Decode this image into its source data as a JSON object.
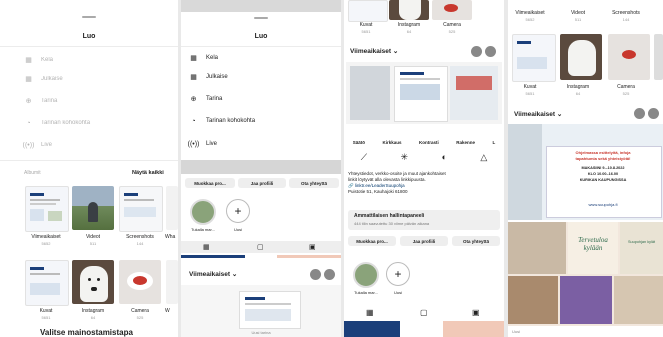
{
  "sheet": {
    "title": "Luo",
    "items": [
      {
        "label": "Kela",
        "icon": "grid-icon"
      },
      {
        "label": "Julkaise",
        "icon": "grid-icon"
      },
      {
        "label": "Tarina",
        "icon": "plus-circle-icon"
      },
      {
        "label": "Tarinan kohokohta",
        "icon": "history-icon"
      },
      {
        "label": "Live",
        "icon": "live-icon"
      }
    ]
  },
  "gallery": {
    "section_label": "Albumit",
    "see_all": "Näytä kaikki",
    "albums": [
      {
        "name": "Viimeaikaiset",
        "count": "5652"
      },
      {
        "name": "Videot",
        "count": "511"
      },
      {
        "name": "Screenshots",
        "count": "144"
      },
      {
        "name": "Wha",
        "count": ""
      }
    ],
    "albums2": [
      {
        "name": "Kuvat",
        "count": "5651"
      },
      {
        "name": "Instagram",
        "count": "64"
      },
      {
        "name": "Camera",
        "count": "525"
      },
      {
        "name": "W",
        "count": ""
      }
    ],
    "footer_text": "Valitse mainostamistapa"
  },
  "profile": {
    "edit_button": "Muokkaa pro...",
    "share_button": "Jaa profiili",
    "contact_button": "Ota yhteyttä",
    "edit_button2": "Muokkaa pro...",
    "share_button2": "Jaa profiili",
    "contact_button2": "Ota yhteyttä",
    "highlight_label": "Tukalla mar...",
    "new_label": "Uusi",
    "recent_label": "Viimeaikaiset",
    "recent_label_top": "Viimeaikaiset",
    "recent_label_right": "Viimeaikaiset",
    "new_story_label": "Uusi tarina"
  },
  "filters": [
    "Säätö",
    "Kirkkaus",
    "Kontrasti",
    "Rakenne",
    "L"
  ],
  "bio": {
    "line1": "Yhteystiedot, verkko-osoite ja muut ajankohtaiset",
    "line2": "linkit löytyvät alla olevasta linkkipuusta.",
    "link": "linktr.ee/LeaderSuupohja",
    "address": "Puistotie 51, Kauhajoki 61800",
    "dashboard_title": "Ammattilaisen hallintapaneeli",
    "dashboard_sub": "444 tilin saavutettu 30 viime päivän aikana"
  },
  "right_albums": [
    {
      "name": "Viimeaikaiset",
      "count": "5652"
    },
    {
      "name": "Videot",
      "count": "511"
    },
    {
      "name": "Screenshots",
      "count": "144"
    }
  ],
  "right_albums2": [
    {
      "name": "Kuvat",
      "count": "5651"
    },
    {
      "name": "Instagram",
      "count": "64"
    },
    {
      "name": "Camera",
      "count": "525"
    }
  ],
  "albums_top_s3": [
    {
      "name": "Kuvat",
      "count": "5651"
    },
    {
      "name": "Instagram",
      "count": "64"
    },
    {
      "name": "Camera",
      "count": "525"
    }
  ],
  "poster": {
    "event_line1": "Ohjelmassa esittelyitä, infoja",
    "event_line2": "tapahtumia sekä yhteistyötä!",
    "dates": "MAKASIINI 9.–10.8.2022",
    "hours": "KLO 10.00–16.00",
    "place": "KURIKAN KAUPUNGISSA",
    "web": "www.suupohja.fi",
    "title": "Tervetuloa kylään",
    "subtitle": "Suupohjan kylät"
  },
  "colors": {
    "accent": "#3897f0",
    "brand_blue": "#1b3f7a",
    "poster_red": "#c8372d"
  }
}
